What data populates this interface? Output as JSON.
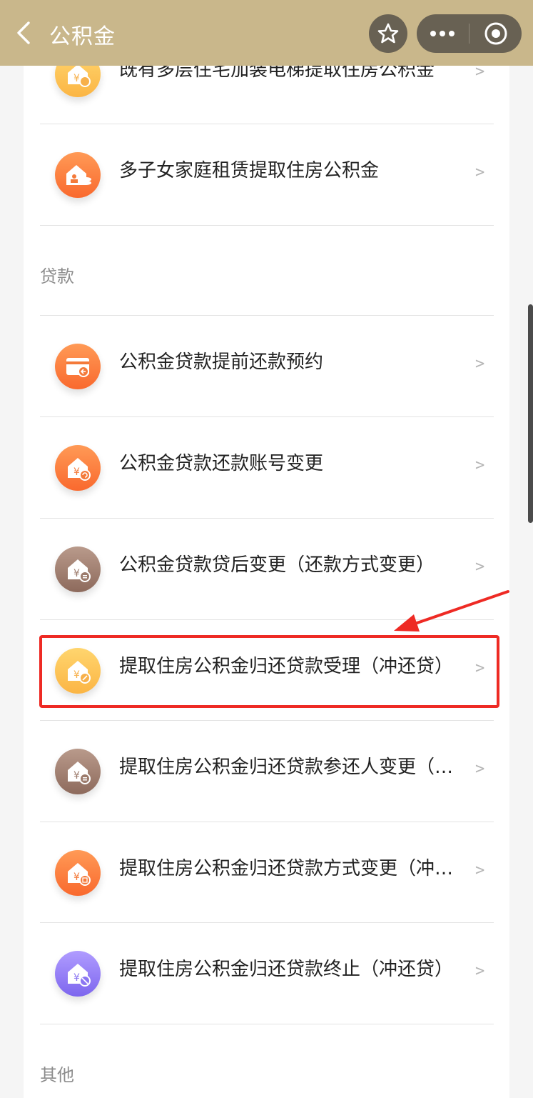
{
  "header": {
    "title": "公积金",
    "back_icon": "back-arrow-icon",
    "star_icon": "star-icon",
    "more_icon": "more-dots-icon",
    "close_icon": "target-circle-icon",
    "bar_color": "#c9b78b"
  },
  "items_top": [
    {
      "label": "既有多层住宅加装电梯提取住房公积金",
      "icon": "house-yen-icon",
      "color": "yellow"
    },
    {
      "label": "多子女家庭租赁提取住房公积金",
      "icon": "house-family-icon",
      "color": "orange"
    }
  ],
  "loan": {
    "section_title": "贷款",
    "items": [
      {
        "label": "公积金贷款提前还款预约",
        "icon": "card-return-icon",
        "color": "orange"
      },
      {
        "label": "公积金贷款还款账号变更",
        "icon": "house-yen-refresh-icon",
        "color": "orange"
      },
      {
        "label": "公积金贷款贷后变更（还款方式变更）",
        "icon": "house-yen-list-icon",
        "color": "brown"
      },
      {
        "label": "提取住房公积金归还贷款受理（冲还贷）",
        "icon": "house-yen-icon",
        "color": "yellow"
      },
      {
        "label": "提取住房公积金归还贷款参还人变更（冲还贷）",
        "icon": "house-yen-list-icon",
        "color": "brown"
      },
      {
        "label": "提取住房公积金归还贷款方式变更（冲还贷）",
        "icon": "house-yen-doc-icon",
        "color": "orange"
      },
      {
        "label": "提取住房公积金归还贷款终止（冲还贷）",
        "icon": "house-yen-stop-icon",
        "color": "purple"
      }
    ]
  },
  "other": {
    "section_title": "其他"
  },
  "chevron": ">",
  "highlight_color": "#ee2a24"
}
